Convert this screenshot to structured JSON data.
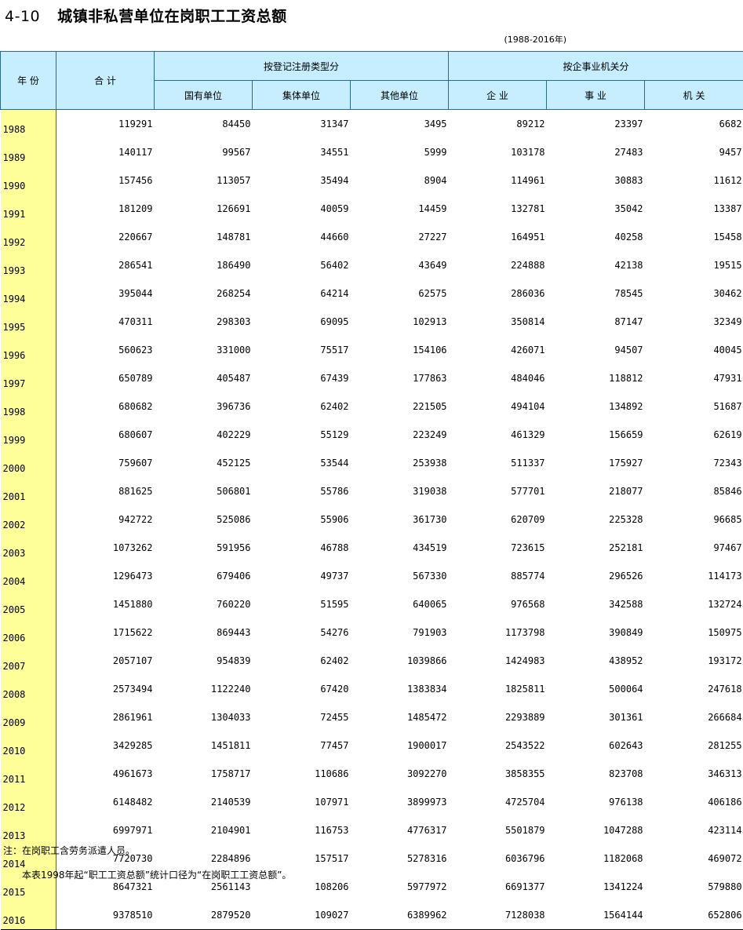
{
  "title": {
    "number": "4-10",
    "text": "城镇非私营单位在岗职工工资总额"
  },
  "range": "(1988-2016年)",
  "headers": {
    "year": "年 份",
    "total": "合 计",
    "group_reg": "按登记注册类型分",
    "group_ent": "按企事业机关分",
    "state": "国有单位",
    "collective": "集体单位",
    "other": "其他单位",
    "enterprise": "企 业",
    "institution": "事 业",
    "agency": "机 关"
  },
  "rows": [
    [
      "1988",
      "119291",
      "84450",
      "31347",
      "3495",
      "89212",
      "23397",
      "6682"
    ],
    [
      "1989",
      "140117",
      "99567",
      "34551",
      "5999",
      "103178",
      "27483",
      "9457"
    ],
    [
      "1990",
      "157456",
      "113057",
      "35494",
      "8904",
      "114961",
      "30883",
      "11612"
    ],
    [
      "1991",
      "181209",
      "126691",
      "40059",
      "14459",
      "132781",
      "35042",
      "13387"
    ],
    [
      "1992",
      "220667",
      "148781",
      "44660",
      "27227",
      "164951",
      "40258",
      "15458"
    ],
    [
      "1993",
      "286541",
      "186490",
      "56402",
      "43649",
      "224888",
      "42138",
      "19515"
    ],
    [
      "1994",
      "395044",
      "268254",
      "64214",
      "62575",
      "286036",
      "78545",
      "30462"
    ],
    [
      "1995",
      "470311",
      "298303",
      "69095",
      "102913",
      "350814",
      "87147",
      "32349"
    ],
    [
      "1996",
      "560623",
      "331000",
      "75517",
      "154106",
      "426071",
      "94507",
      "40045"
    ],
    [
      "1997",
      "650789",
      "405487",
      "67439",
      "177863",
      "484046",
      "118812",
      "47931"
    ],
    [
      "1998",
      "680682",
      "396736",
      "62402",
      "221505",
      "494104",
      "134892",
      "51687"
    ],
    [
      "1999",
      "680607",
      "402229",
      "55129",
      "223249",
      "461329",
      "156659",
      "62619"
    ],
    [
      "2000",
      "759607",
      "452125",
      "53544",
      "253938",
      "511337",
      "175927",
      "72343"
    ],
    [
      "2001",
      "881625",
      "506801",
      "55786",
      "319038",
      "577701",
      "218077",
      "85846"
    ],
    [
      "2002",
      "942722",
      "525086",
      "55906",
      "361730",
      "620709",
      "225328",
      "96685"
    ],
    [
      "2003",
      "1073262",
      "591956",
      "46788",
      "434519",
      "723615",
      "252181",
      "97467"
    ],
    [
      "2004",
      "1296473",
      "679406",
      "49737",
      "567330",
      "885774",
      "296526",
      "114173"
    ],
    [
      "2005",
      "1451880",
      "760220",
      "51595",
      "640065",
      "976568",
      "342588",
      "132724"
    ],
    [
      "2006",
      "1715622",
      "869443",
      "54276",
      "791903",
      "1173798",
      "390849",
      "150975"
    ],
    [
      "2007",
      "2057107",
      "954839",
      "62402",
      "1039866",
      "1424983",
      "438952",
      "193172"
    ],
    [
      "2008",
      "2573494",
      "1122240",
      "67420",
      "1383834",
      "1825811",
      "500064",
      "247618"
    ],
    [
      "2009",
      "2861961",
      "1304033",
      "72455",
      "1485472",
      "2293889",
      "301361",
      "266684"
    ],
    [
      "2010",
      "3429285",
      "1451811",
      "77457",
      "1900017",
      "2543522",
      "602643",
      "281255"
    ],
    [
      "2011",
      "4961673",
      "1758717",
      "110686",
      "3092270",
      "3858355",
      "823708",
      "346313"
    ],
    [
      "2012",
      "6148482",
      "2140539",
      "107971",
      "3899973",
      "4725704",
      "976138",
      "406186"
    ],
    [
      "2013",
      "6997971",
      "2104901",
      "116753",
      "4776317",
      "5501879",
      "1047288",
      "423114"
    ],
    [
      "2014",
      "7720730",
      "2284896",
      "157517",
      "5278316",
      "6036796",
      "1182068",
      "469072"
    ],
    [
      "2015",
      "8647321",
      "2561143",
      "108206",
      "5977972",
      "6691377",
      "1341224",
      "579880"
    ],
    [
      "2016",
      "9378510",
      "2879520",
      "109027",
      "6389962",
      "7128038",
      "1564144",
      "652806"
    ]
  ],
  "notes": {
    "note1": "注：在岗职工含劳务派遣人员。",
    "note2": "本表1998年起“职工工资总额”统计口径为“在岗职工工资总额”。"
  }
}
